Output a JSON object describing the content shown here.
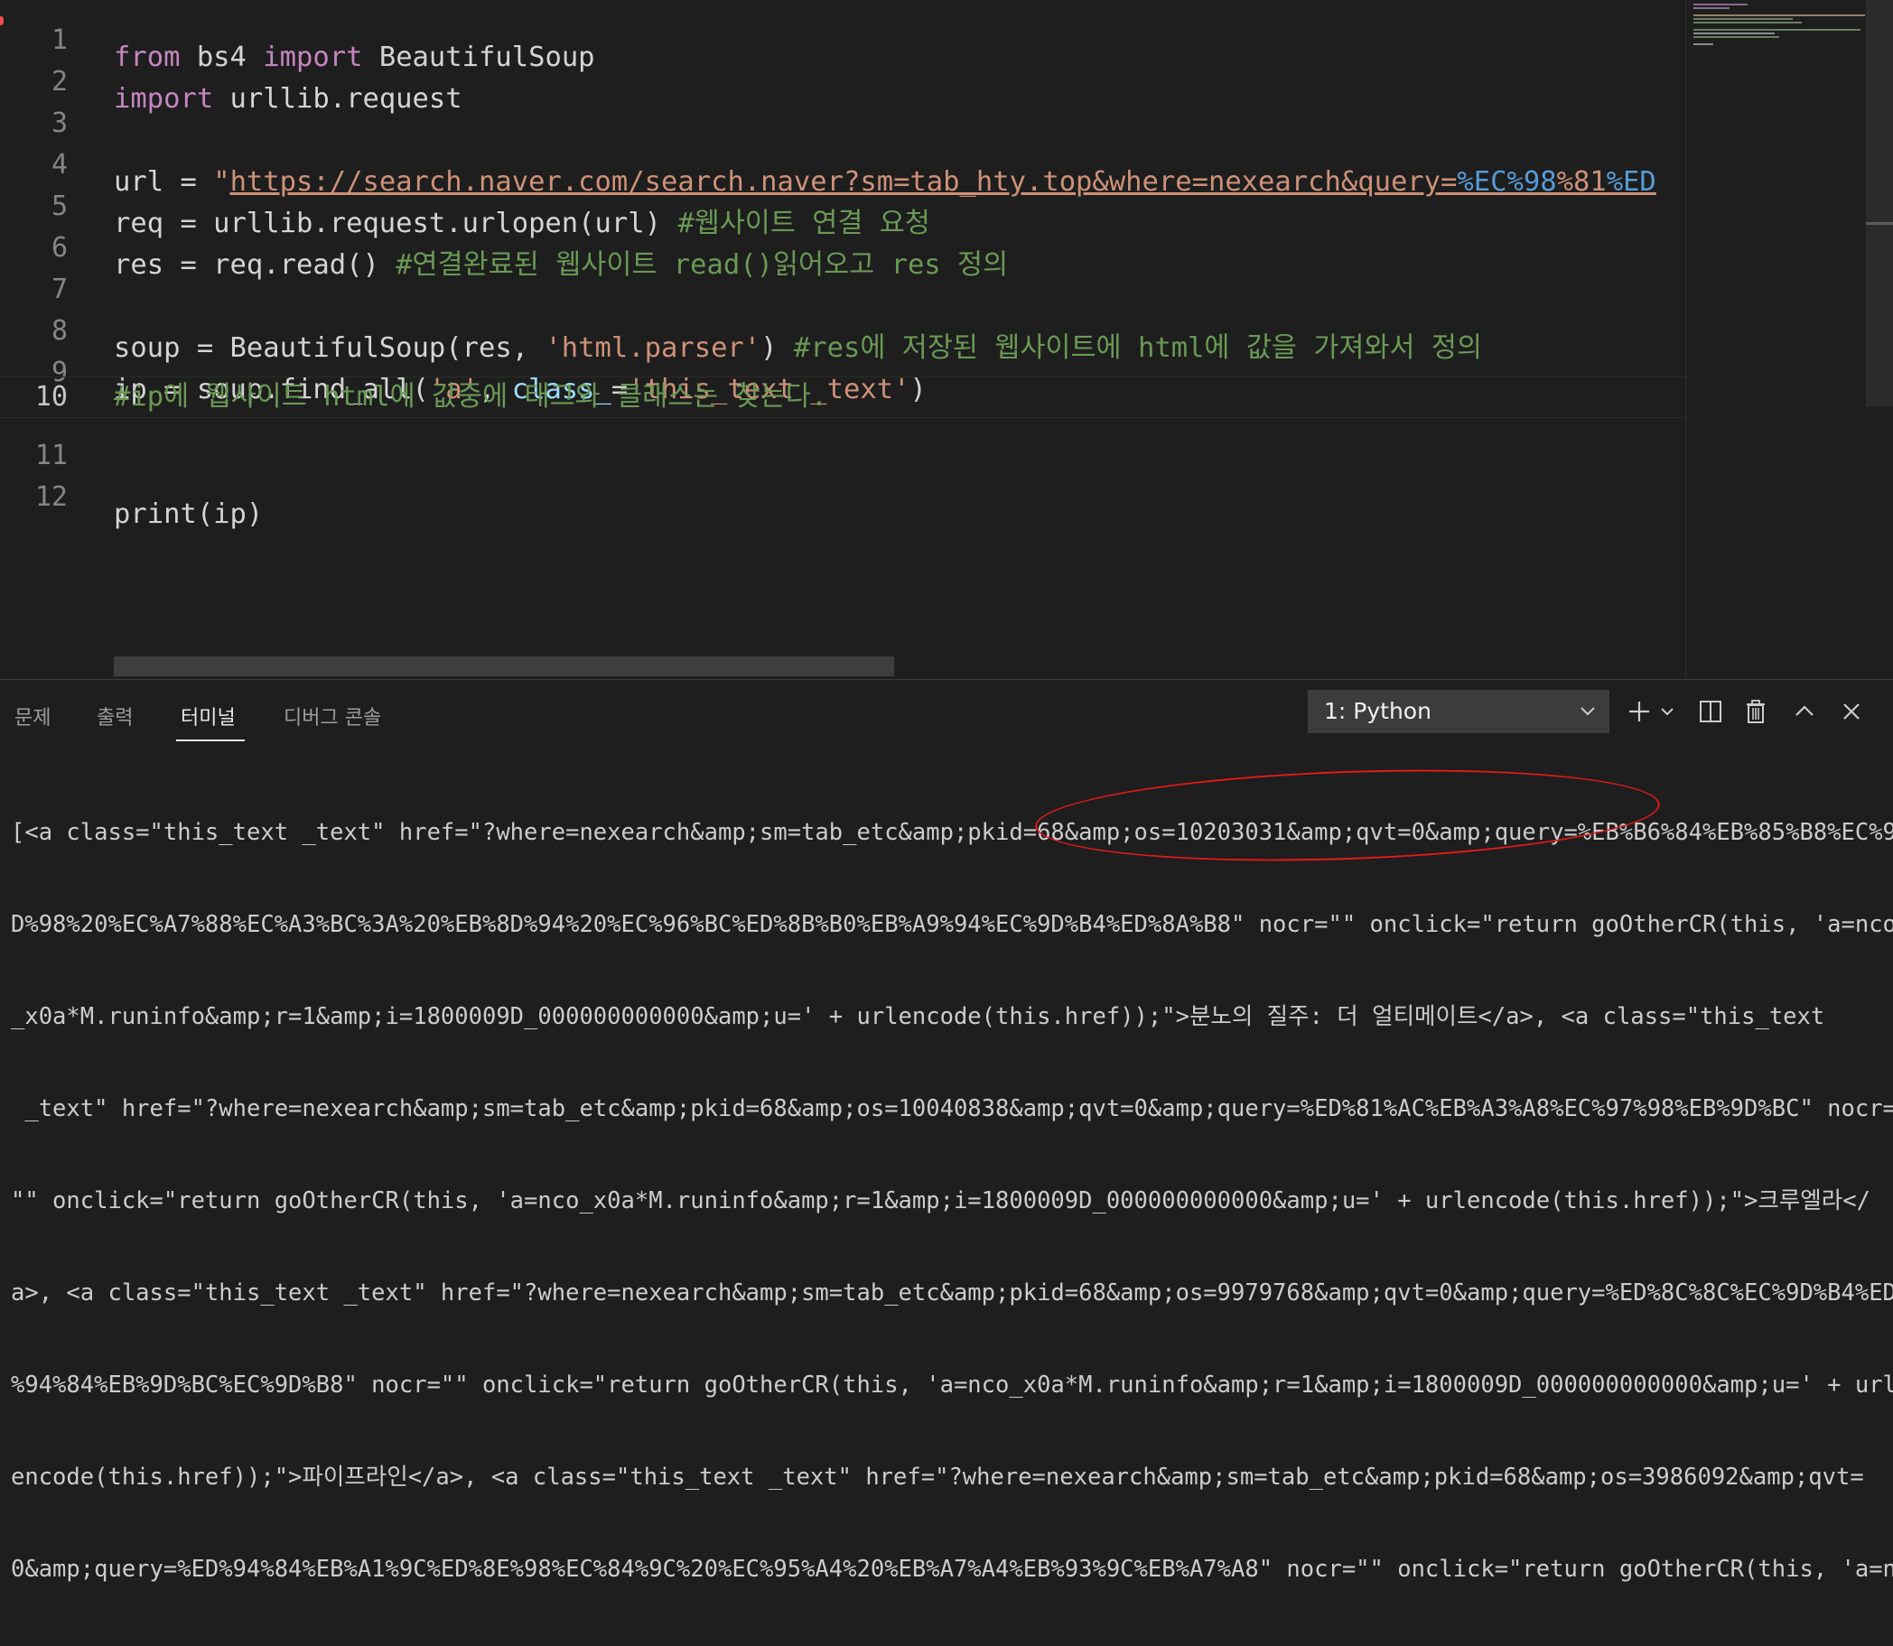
{
  "editor": {
    "lines": [
      {
        "num": "1"
      },
      {
        "num": "2"
      },
      {
        "num": "3"
      },
      {
        "num": "4"
      },
      {
        "num": "5"
      },
      {
        "num": "6"
      },
      {
        "num": "7"
      },
      {
        "num": "8"
      },
      {
        "num": "9"
      },
      {
        "num": "10"
      },
      {
        "num": "11"
      },
      {
        "num": "12"
      }
    ],
    "l1": {
      "kw1": "from",
      "mod": " bs4 ",
      "kw2": "import",
      "name": " BeautifulSoup"
    },
    "l2": {
      "kw": "import",
      "mod": " urllib.request"
    },
    "l4": {
      "lhs": "url = ",
      "quote": "\"",
      "url_text": "https://search.naver.com/search.naver?sm=tab_hty.top&where=nexearch&query=",
      "e1": "%EC",
      "e1b": "%98",
      "e2": "%81",
      "e3": "%ED"
    },
    "l5": {
      "code": "req = urllib.request.urlopen(url) ",
      "comment": "#웹사이트 연결 요청"
    },
    "l6": {
      "code": "res = req.read() ",
      "comment": "#연결완료된 웹사이트 read()읽어오고 res 정의"
    },
    "l8": {
      "code": "soup = BeautifulSoup(res, ",
      "str": "'html.parser'",
      "close": ") ",
      "comment": "#res에 저장된 웹사이트에 html에 값을 가져와서 정의"
    },
    "l9": {
      "code": "ip = soup.find_all(",
      "s1": "'a'",
      "comma": ", ",
      "kwarg": "class_",
      "eq": "=",
      "s2": "'this_text _text'",
      "close": ")"
    },
    "l10": {
      "comment": "#ip에 웹사이트 html에 값중에 태그와 클래스는 찾는다."
    },
    "l12": {
      "code": "print(ip)"
    }
  },
  "panel": {
    "tabs": [
      "문제",
      "출력",
      "터미널",
      "디버그 콘솔"
    ],
    "active_tab": "터미널",
    "terminal_select": "1: Python",
    "terminal_lines": [
      "[<a class=\"this_text _text\" href=\"?where=nexearch&amp;sm=tab_etc&amp;pkid=68&amp;os=10203031&amp;qvt=0&amp;query=%EB%B6%84%EB%85%B8%EC%9",
      "D%98%20%EC%A7%88%EC%A3%BC%3A%20%EB%8D%94%20%EC%96%BC%ED%8B%B0%EB%A9%94%EC%9D%B4%ED%8A%B8\" nocr=\"\" onclick=\"return goOtherCR(this, 'a=nco",
      "_x0a*M.runinfo&amp;r=1&amp;i=1800009D_000000000000&amp;u=' + urlencode(this.href));\">분노의 질주: 더 얼티메이트</a>, <a class=\"this_text",
      " _text\" href=\"?where=nexearch&amp;sm=tab_etc&amp;pkid=68&amp;os=10040838&amp;qvt=0&amp;query=%ED%81%AC%EB%A3%A8%EC%97%98%EB%9D%BC\" nocr=",
      "\"\" onclick=\"return goOtherCR(this, 'a=nco_x0a*M.runinfo&amp;r=1&amp;i=1800009D_000000000000&amp;u=' + urlencode(this.href));\">크루엘라</",
      "a>, <a class=\"this_text _text\" href=\"?where=nexearch&amp;sm=tab_etc&amp;pkid=68&amp;os=9979768&amp;qvt=0&amp;query=%ED%8C%8C%EC%9D%B4%ED",
      "%94%84%EB%9D%BC%EC%9D%B8\" nocr=\"\" onclick=\"return goOtherCR(this, 'a=nco_x0a*M.runinfo&amp;r=1&amp;i=1800009D_000000000000&amp;u=' + url",
      "encode(this.href));\">파이프라인</a>, <a class=\"this_text _text\" href=\"?where=nexearch&amp;sm=tab_etc&amp;pkid=68&amp;os=3986092&amp;qvt=",
      "0&amp;query=%ED%94%84%EB%A1%9C%ED%8E%98%EC%84%9C%20%EC%95%A4%20%EB%A7%A4%EB%93%9C%EB%A7%A8\" nocr=\"\" onclick=\"return goOtherCR(this, 'a=n"
    ]
  },
  "colors": {
    "keyword": "#c586c0",
    "string": "#ce9178",
    "comment": "#6a9955",
    "escape": "#569cd6",
    "annotation": "#e21a1a"
  }
}
